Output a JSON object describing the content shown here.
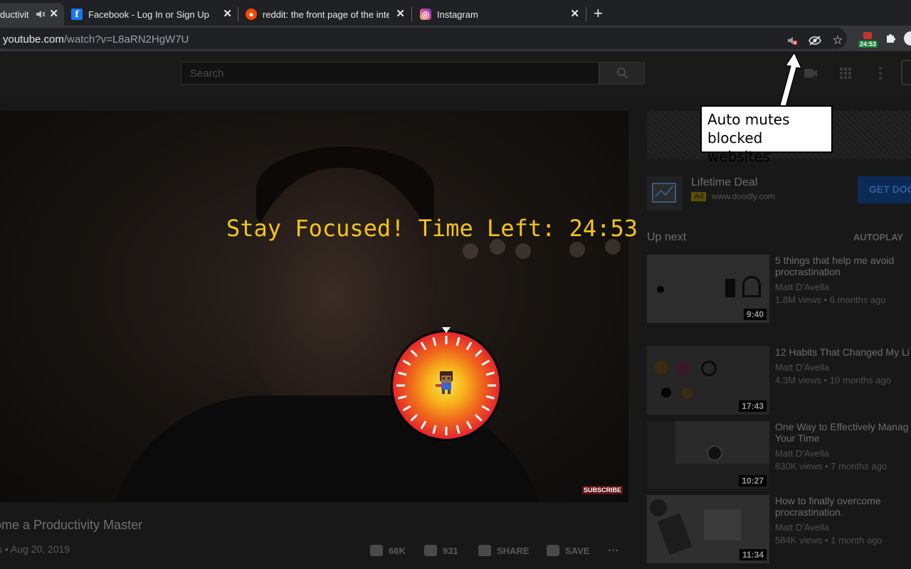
{
  "browser": {
    "tabs": [
      {
        "title": "ductivit",
        "active": true
      },
      {
        "title": "Facebook - Log In or Sign Up",
        "favicon": "f"
      },
      {
        "title": "reddit: the front page of the inter",
        "favicon": "r"
      },
      {
        "title": "Instagram",
        "favicon": "ig"
      }
    ],
    "url_host": "youtube.com",
    "url_path": "/watch?v=L8aRN2HgW7U",
    "extension_badge": "24:53"
  },
  "youtube": {
    "search_placeholder": "Search",
    "overlay_text": "Stay Focused! Time Left: 24:53",
    "video_title": "ome a Productivity Master",
    "meta": "s • Aug 20, 2019",
    "actions": {
      "likes": "66K",
      "dislikes": "931",
      "share": "SHARE",
      "save": "SAVE",
      "more": "···"
    },
    "subscribe_watermark": "SUBSCRIBE",
    "ad": {
      "title": "Lifetime Deal",
      "tag": "Ad",
      "url": "www.doodly.com",
      "cta": "GET DOO"
    },
    "up_next_label": "Up next",
    "autoplay_label": "AUTOPLAY",
    "videos": [
      {
        "title": "5 things that help me avoid procrastination",
        "channel": "Matt D'Avella",
        "stats": "1.8M views • 6 months ago",
        "duration": "9:40"
      },
      {
        "title": "12 Habits That Changed My Li",
        "channel": "Matt D'Avella",
        "stats": "4.3M views • 10 months ago",
        "duration": "17:43"
      },
      {
        "title": "One Way to Effectively Manag Your Time",
        "channel": "Matt D'Avella",
        "stats": "830K views • 7 months ago",
        "duration": "10:27"
      },
      {
        "title": "How to finally overcome procrastination.",
        "channel": "Matt D'Avella",
        "stats": "584K views • 1 month ago",
        "duration": "11:34"
      }
    ]
  },
  "callout": {
    "line1": "Auto mutes",
    "line2": "blocked websites"
  },
  "colors": {
    "overlay_text": "#f5c518",
    "dial_outer": "#e6262c",
    "dial_inner": "#f7d51c",
    "badge": "#188038"
  }
}
